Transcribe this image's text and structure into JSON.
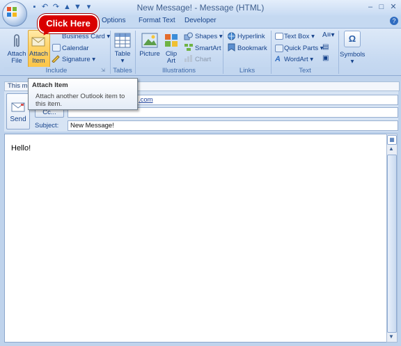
{
  "window": {
    "title": "New Message! - Message (HTML)",
    "controls": [
      "–",
      "□",
      "✕"
    ]
  },
  "callout": {
    "text": "Click Here"
  },
  "tabs": [
    {
      "label": "Options"
    },
    {
      "label": "Format Text"
    },
    {
      "label": "Developer"
    }
  ],
  "ribbon": {
    "include": {
      "label": "Include",
      "attach_file_line1": "Attach",
      "attach_file_line2": "File",
      "attach_item_line1": "Attach",
      "attach_item_line2": "Item",
      "business_card": "Business Card",
      "calendar": "Calendar",
      "signature": "Signature"
    },
    "tables": {
      "label": "Tables",
      "table": "Table"
    },
    "illustrations": {
      "label": "Illustrations",
      "picture": "Picture",
      "clip_art_line1": "Clip",
      "clip_art_line2": "Art",
      "shapes": "Shapes",
      "smartart": "SmartArt",
      "chart": "Chart"
    },
    "links": {
      "label": "Links",
      "hyperlink": "Hyperlink",
      "bookmark": "Bookmark"
    },
    "text": {
      "label": "Text",
      "text_box": "Text Box",
      "quick_parts": "Quick Parts",
      "wordart": "WordArt"
    },
    "symbols": {
      "symbol_glyph": "Ω",
      "label": "Symbols"
    }
  },
  "tooltip": {
    "title": "Attach Item",
    "body": "Attach another Outlook item to this item."
  },
  "infobar": {
    "text": "This me"
  },
  "header": {
    "send": "Send",
    "to_value_visible": ".com",
    "cc_button": "Cc...",
    "subject_label": "Subject:",
    "subject_value": "New Message!"
  },
  "body": {
    "text": "Hello!"
  },
  "colors": {
    "callout": "#d90000",
    "ribbon_bg": "#c6d9f1",
    "title_text": "#3e5e8d"
  }
}
